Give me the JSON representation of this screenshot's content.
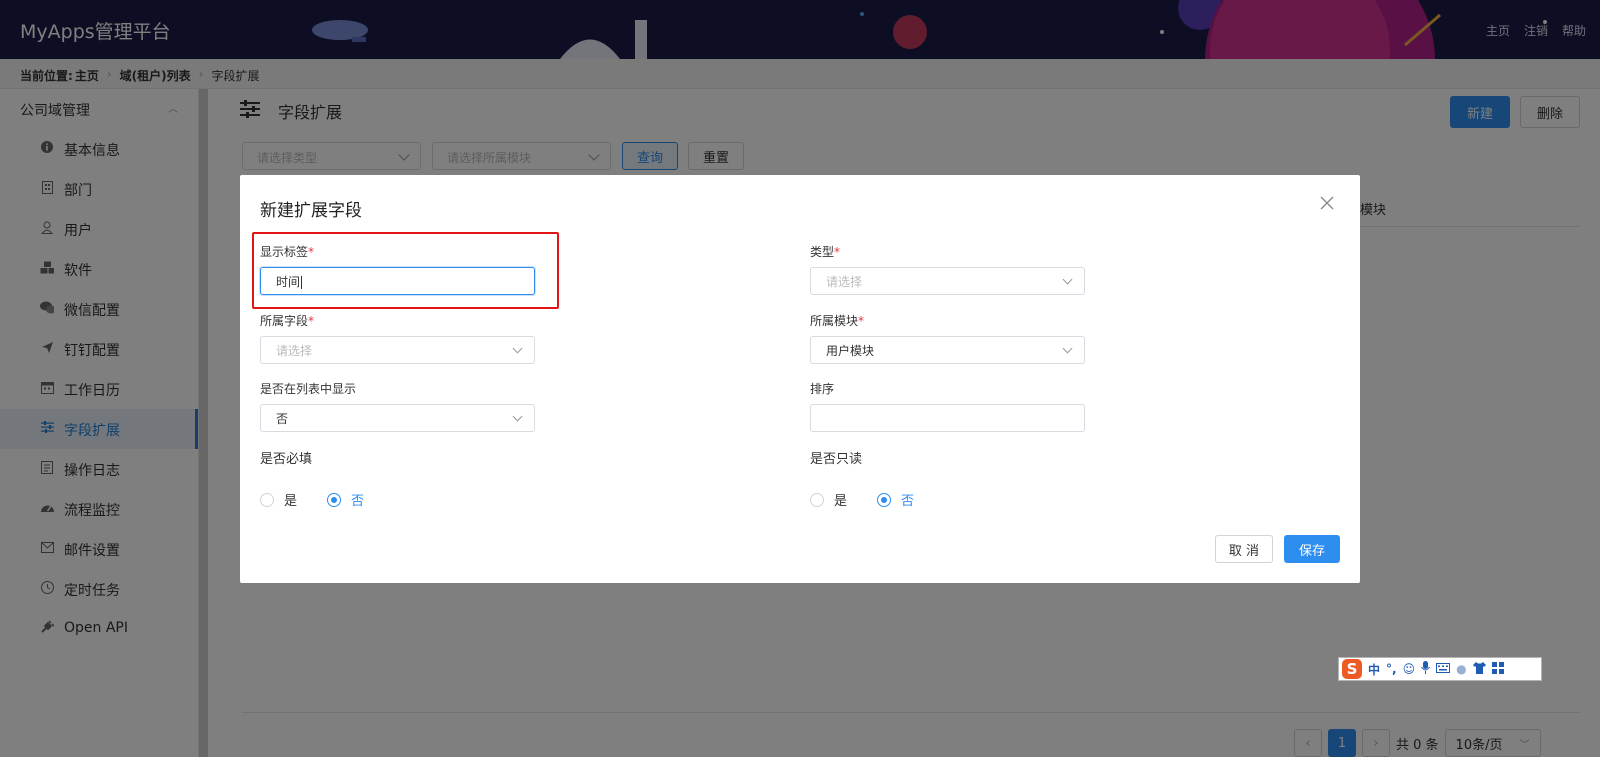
{
  "app": {
    "title": "MyApps管理平台"
  },
  "header_nav": [
    "主页",
    "注销",
    "帮助"
  ],
  "breadcrumb": {
    "prefix": "当前位置:",
    "items": [
      "主页",
      "域(租户)列表",
      "字段扩展"
    ]
  },
  "sidebar": {
    "group": "公司域管理",
    "items": [
      {
        "label": "基本信息",
        "icon": "info-icon"
      },
      {
        "label": "部门",
        "icon": "building-icon"
      },
      {
        "label": "用户",
        "icon": "user-icon"
      },
      {
        "label": "软件",
        "icon": "cubes-icon"
      },
      {
        "label": "微信配置",
        "icon": "wechat-icon"
      },
      {
        "label": "钉钉配置",
        "icon": "plane-icon"
      },
      {
        "label": "工作日历",
        "icon": "calendar-icon"
      },
      {
        "label": "字段扩展",
        "icon": "sliders-icon",
        "active": true
      },
      {
        "label": "操作日志",
        "icon": "log-icon"
      },
      {
        "label": "流程监控",
        "icon": "dashboard-icon"
      },
      {
        "label": "邮件设置",
        "icon": "mail-icon"
      },
      {
        "label": "定时任务",
        "icon": "clock-icon"
      },
      {
        "label": "Open API",
        "icon": "plug-icon"
      }
    ]
  },
  "page": {
    "title": "字段扩展",
    "new_label": "新建",
    "delete_label": "删除",
    "filter_type_placeholder": "请选择类型",
    "filter_module_placeholder": "请选择所属模块",
    "query_label": "查询",
    "reset_label": "重置",
    "column_partial": "模块",
    "pagination": {
      "page": "1",
      "total": "共 0 条",
      "page_size": "10条/页"
    }
  },
  "modal": {
    "title": "新建扩展字段",
    "fields": {
      "display_label": {
        "label": "显示标签",
        "value": "时间"
      },
      "type": {
        "label": "类型",
        "placeholder": "请选择"
      },
      "field": {
        "label": "所属字段",
        "placeholder": "请选择"
      },
      "module": {
        "label": "所属模块",
        "value": "用户模块"
      },
      "show_in_list": {
        "label": "是否在列表中显示",
        "value": "否"
      },
      "sort": {
        "label": "排序",
        "value": ""
      },
      "required": {
        "label": "是否必填",
        "options": [
          "是",
          "否"
        ],
        "selected": "否"
      },
      "readonly": {
        "label": "是否只读",
        "options": [
          "是",
          "否"
        ],
        "selected": "否"
      }
    },
    "cancel_label": "取 消",
    "save_label": "保存"
  },
  "ime": {
    "mode": "中",
    "punct": "°,"
  },
  "colors": {
    "primary": "#2e8ef0",
    "header_bg": "#1b1a48",
    "highlight": "#e21414"
  }
}
